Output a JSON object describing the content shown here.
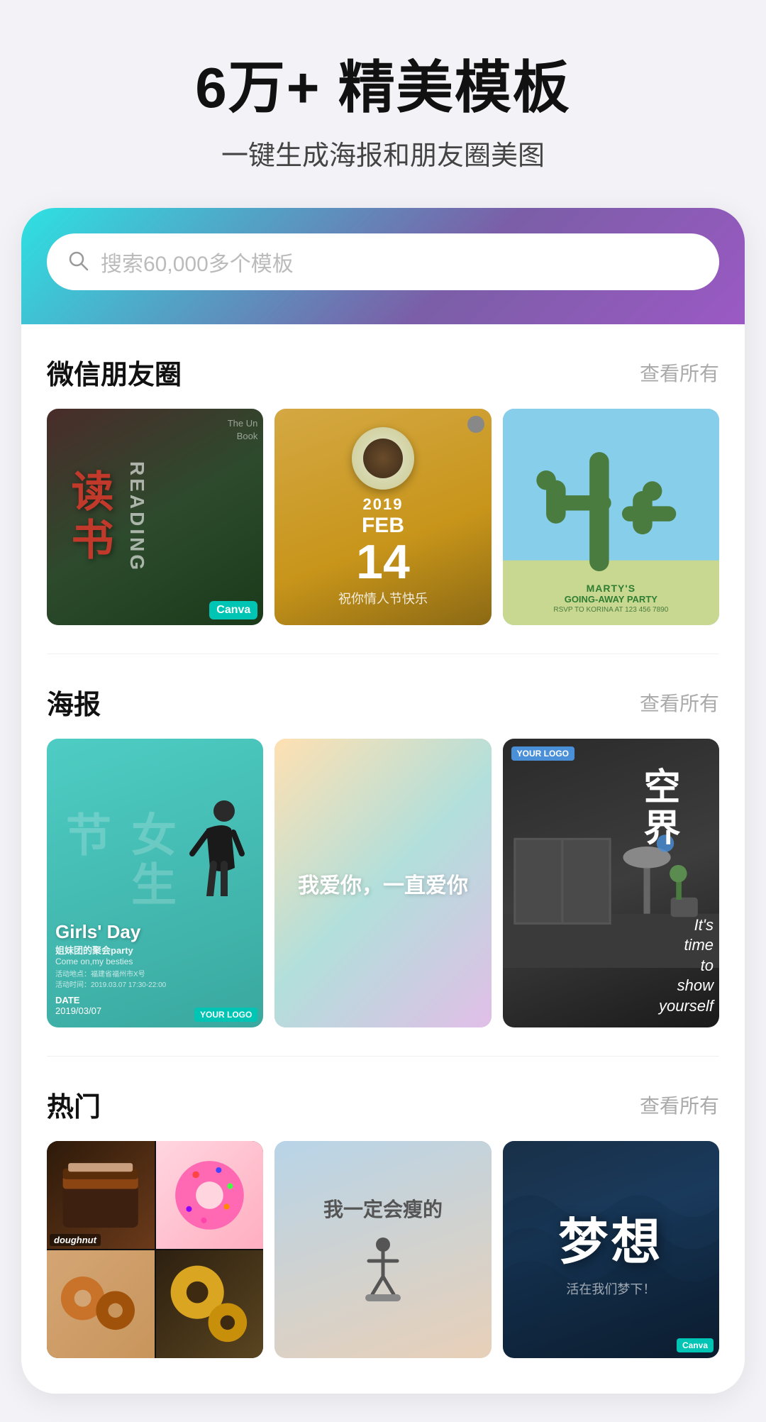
{
  "hero": {
    "title": "6万+ 精美模板",
    "subtitle": "一键生成海报和朋友圈美图"
  },
  "search": {
    "placeholder": "搜索60,000多个模板"
  },
  "sections": {
    "wechat": {
      "title": "微信朋友圈",
      "viewall": "查看所有",
      "cards": [
        {
          "type": "reading",
          "text": "读书",
          "vertical": "READING"
        },
        {
          "type": "valentine",
          "date": "14",
          "month": "FEB",
          "year": "2019",
          "subtitle": "祝你情人节快乐"
        },
        {
          "type": "party",
          "title": "Marty's Going-away Party"
        }
      ]
    },
    "poster": {
      "title": "海报",
      "viewall": "查看所有",
      "cards": [
        {
          "type": "girlsday",
          "main": "女生节",
          "event": "Girls' Day",
          "sub": "姐妹团的聚会party Come on,my besties",
          "date": "DATE 2019/03/07"
        },
        {
          "type": "love",
          "text": "我爱你，一直爱你"
        },
        {
          "type": "space",
          "title": "空界",
          "sub": "It's time to show yourself"
        }
      ]
    },
    "hot": {
      "title": "热门",
      "viewall": "查看所有",
      "cards": [
        {
          "type": "doughnut",
          "label": "doughnut"
        },
        {
          "type": "resolve",
          "text": "我一定会瘦的"
        },
        {
          "type": "dream",
          "main": "梦想",
          "sub": "活在我们梦下！"
        }
      ]
    }
  }
}
